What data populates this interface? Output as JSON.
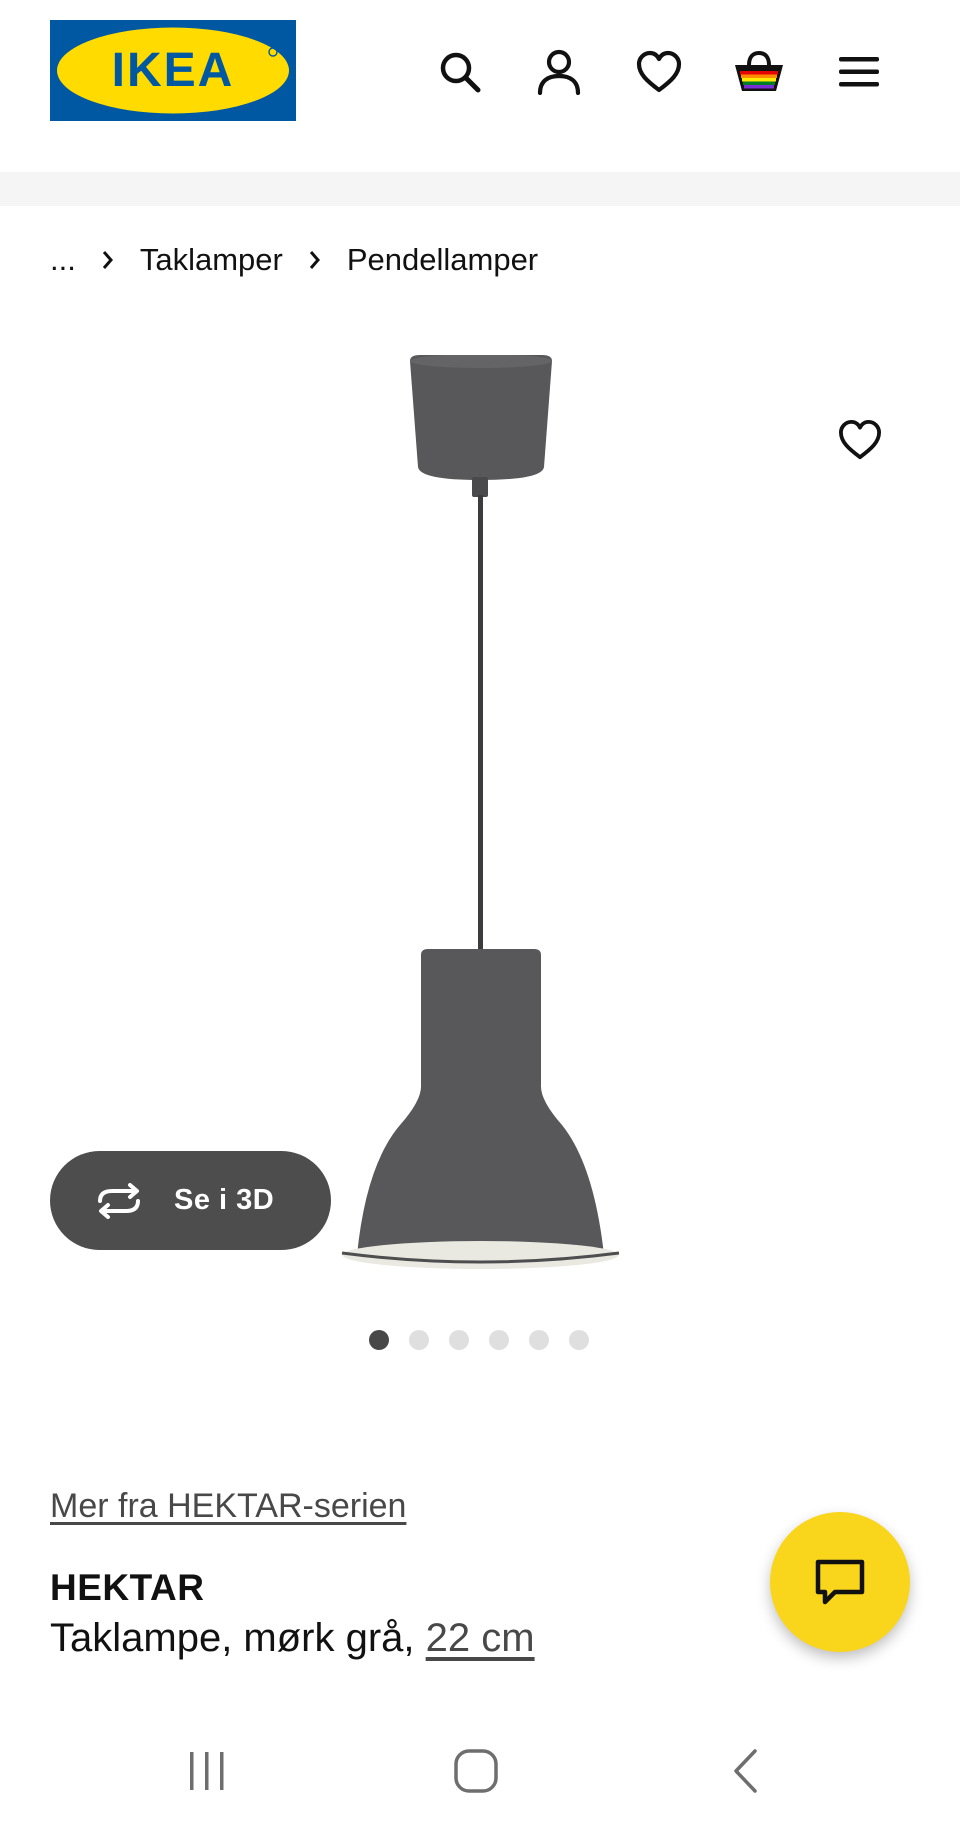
{
  "header": {
    "logo_text": "IKEA",
    "icons": [
      "search-icon",
      "account-icon",
      "heart-icon",
      "basket-icon",
      "menu-icon"
    ],
    "brand_blue": "#0058A3",
    "brand_yellow": "#FFDB00"
  },
  "breadcrumb": {
    "items": [
      "...",
      "Taklamper",
      "Pendellamper"
    ]
  },
  "gallery": {
    "view_3d_label": "Se i 3D",
    "image_count": 6,
    "active_index": 0
  },
  "product": {
    "series_link": "Mer fra HEKTAR-serien",
    "name": "HEKTAR",
    "description": "Taklampe, mørk grå, ",
    "size": "22 cm"
  },
  "chat": {
    "icon": "chat-icon",
    "color": "#F9D51B"
  },
  "system_nav": {
    "icons": [
      "recent-apps-icon",
      "home-icon",
      "back-icon"
    ]
  }
}
